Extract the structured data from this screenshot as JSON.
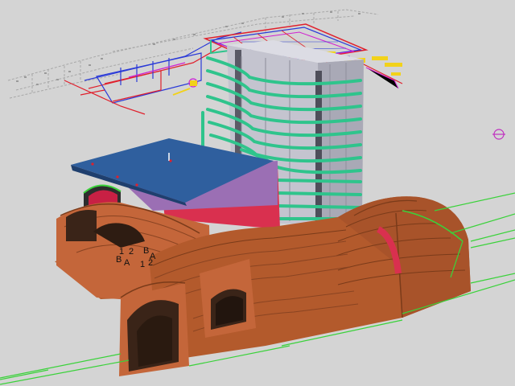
{
  "viewport": {
    "background": "#d4d4d4",
    "colors": {
      "tunnel_lining": "#b35a2c",
      "tunnel_shadow": "#7a3b1a",
      "tunnel_dark": "#3a2418",
      "roof_slab": "#2f5f9e",
      "wall_purple": "#9b6fb4",
      "wall_red": "#d9304f",
      "tower_grey": "#b9b9c4",
      "rebar_green": "#2fc48c",
      "drawing_red": "#e0202c",
      "drawing_blue": "#2a3ad8",
      "drawing_magenta": "#d020d0",
      "drawing_yellow": "#f2d21a",
      "alignment_green": "#3ad23a"
    }
  },
  "grid_markers": {
    "set_left": [
      "B",
      "A",
      "1",
      "2"
    ],
    "set_right": [
      "B",
      "A",
      "1",
      "2"
    ]
  }
}
